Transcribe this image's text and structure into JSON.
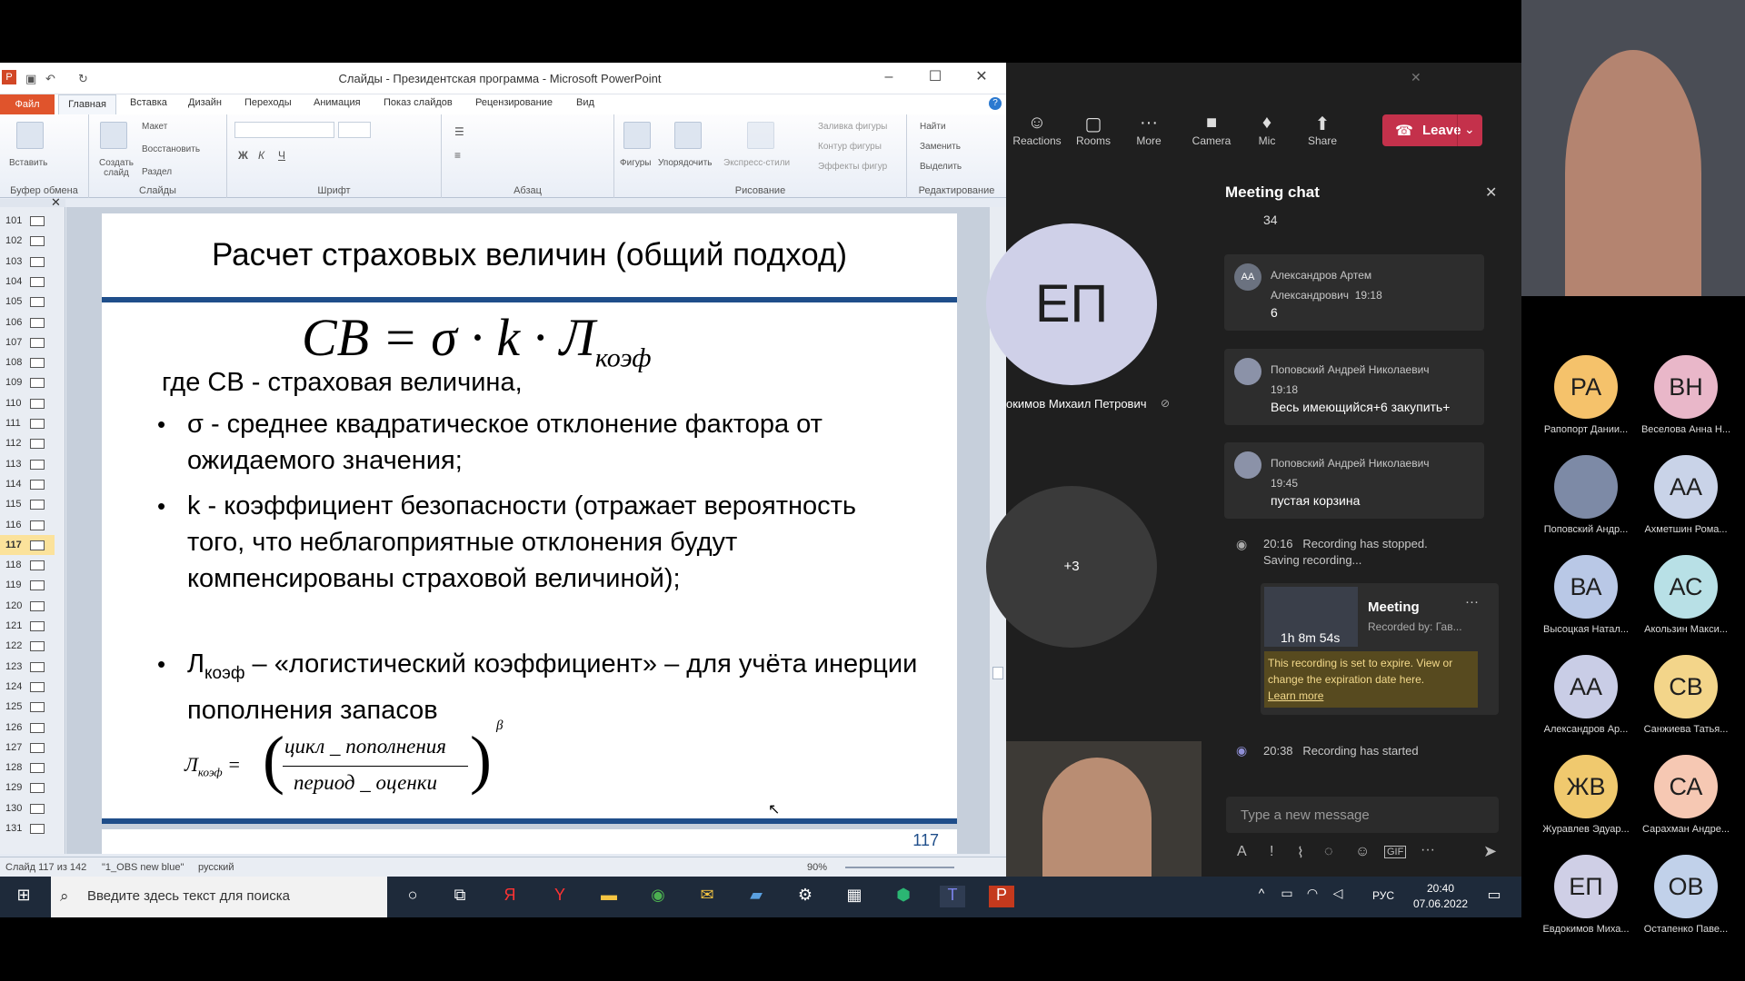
{
  "ppt": {
    "title": "Слайды - Президентская программа - Microsoft PowerPoint",
    "tabs": [
      "Файл",
      "Главная",
      "Вставка",
      "Дизайн",
      "Переходы",
      "Анимация",
      "Показ слайдов",
      "Рецензирование",
      "Вид"
    ],
    "groups": {
      "clipboard": "Буфер обмена",
      "slides": "Слайды",
      "font": "Шрифт",
      "paragraph": "Абзац",
      "drawing": "Рисование",
      "editing": "Редактирование"
    },
    "buttons": {
      "paste": "Вставить",
      "new_slide": "Создать слайд",
      "layout": "Макет",
      "reset": "Восстановить",
      "section": "Раздел",
      "shapes": "Фигуры",
      "arrange": "Упорядочить",
      "quick_styles": "Экспресс-стили",
      "shape_fill": "Заливка фигуры",
      "shape_outline": "Контур фигуры",
      "shape_effects": "Эффекты фигур",
      "find": "Найти",
      "replace": "Заменить",
      "select": "Выделить"
    },
    "slide_numbers": [
      "101",
      "102",
      "103",
      "104",
      "105",
      "106",
      "107",
      "108",
      "109",
      "110",
      "111",
      "112",
      "113",
      "114",
      "115",
      "116",
      "117",
      "118",
      "119",
      "120",
      "121",
      "122",
      "123",
      "124",
      "125",
      "126",
      "127",
      "128",
      "129",
      "130",
      "131"
    ],
    "selected_slide": "117",
    "slide": {
      "title": "Расчет страховых величин (общий подход)",
      "formula_main": "СВ = σ · k · Л",
      "formula_sub": "коэф",
      "where_line": "где СВ - страховая величина,",
      "bullet1": "σ - среднее квадратическое отклонение фактора от ожидаемого значения;",
      "bullet2": "k - коэффициент безопасности (отражает вероятность того, что неблагоприятные отклонения будут компенсированы страховой величиной);",
      "bullet3_main": "Л",
      "bullet3_sub": "коэф",
      "bullet3_rest": " – «логистический коэффициент» – для учёта инерции пополнения запасов",
      "f2_left": "Л",
      "f2_left_sub": "коэф",
      "f2_num": "цикл _ пополнения",
      "f2_den": "период _ оценки",
      "f2_exp": "β",
      "page_number": "117"
    },
    "status": {
      "slide_info": "Слайд 117 из 142",
      "theme": "\"1_OBS new blue\"",
      "language": "русский",
      "zoom": "90%"
    }
  },
  "teams": {
    "toolbar": [
      {
        "label": "Reactions",
        "icon": "☺"
      },
      {
        "label": "Rooms",
        "icon": "▢"
      },
      {
        "label": "More",
        "icon": "···"
      },
      {
        "label": "Camera",
        "icon": "■"
      },
      {
        "label": "Mic",
        "icon": "♦"
      },
      {
        "label": "Share",
        "icon": "⬆"
      }
    ],
    "leave_label": "Leave",
    "stage": {
      "avatar_initials": "ЕП",
      "avatar_name": "окимов Михаил Петрович",
      "overflow": "+3"
    },
    "chat": {
      "title": "Meeting chat",
      "top_clip": "34",
      "messages": [
        {
          "initials": "АА",
          "name": "Александров Артем Александрович",
          "time": "19:18",
          "text": "6"
        },
        {
          "initials": "",
          "name": "Поповский Андрей Николаевич",
          "time": "19:18",
          "text": "Весь имеющийся+6 закупить+"
        },
        {
          "initials": "",
          "name": "Поповский Андрей Николаевич",
          "time": "19:45",
          "text": "пустая корзина"
        }
      ],
      "sys1_time": "20:16",
      "sys1_text": "Recording has stopped. Saving recording...",
      "card_title": "Meeting",
      "card_by": "Recorded by: Гав...",
      "card_duration": "1h 8m 54s",
      "card_warning": "This recording is set to expire. View or change the expiration date here.",
      "card_learn": "Learn more",
      "sys2_time": "20:38",
      "sys2_text": "Recording has started",
      "input_placeholder": "Type a new message"
    }
  },
  "gallery": [
    {
      "initials": "РА",
      "name": "Рапопорт Дании...",
      "color": "#f5c26b"
    },
    {
      "initials": "ВН",
      "name": "Веселова Анна Н...",
      "color": "#e9b7c9"
    },
    {
      "initials": "",
      "name": "Поповский Андр...",
      "color": "#7d8aa6"
    },
    {
      "initials": "АА",
      "name": "Ахметшин Рома...",
      "color": "#c9d3e8"
    },
    {
      "initials": "ВА",
      "name": "Высоцкая Натал...",
      "color": "#b9c8e6"
    },
    {
      "initials": "АС",
      "name": "Акользин Макси...",
      "color": "#b8e0e6"
    },
    {
      "initials": "АА",
      "name": "Александров Ар...",
      "color": "#c9cde6"
    },
    {
      "initials": "СВ",
      "name": "Санжиева Татья...",
      "color": "#f3d58a"
    },
    {
      "initials": "ЖВ",
      "name": "Журавлев Эдуар...",
      "color": "#f0c96e"
    },
    {
      "initials": "СА",
      "name": "Сарахман Андре...",
      "color": "#f6c8b3"
    },
    {
      "initials": "ЕП",
      "name": "Евдокимов Миха...",
      "color": "#cfcfe6"
    },
    {
      "initials": "ОВ",
      "name": "Остапенко Паве...",
      "color": "#c1d1ea"
    }
  ],
  "taskbar": {
    "search_placeholder": "Введите здесь текст для поиска",
    "lang": "РУС",
    "time": "20:40",
    "date": "07.06.2022"
  }
}
